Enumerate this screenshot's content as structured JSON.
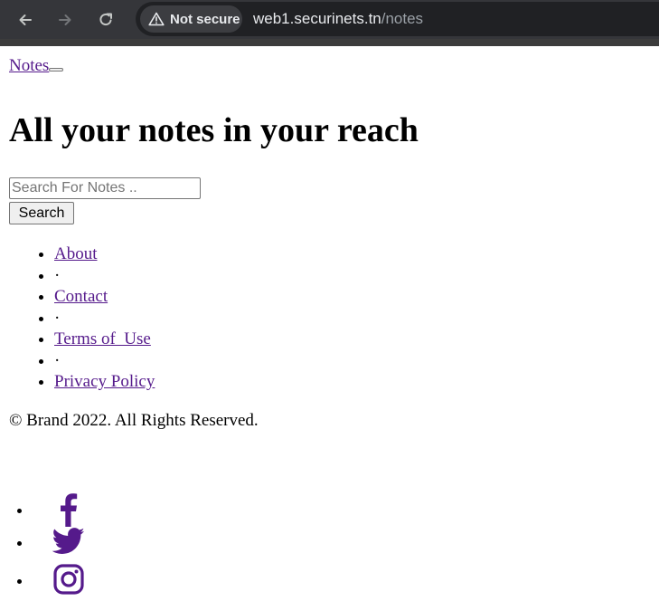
{
  "browser": {
    "security_label": "Not secure",
    "url_host": "web1.securinets.tn",
    "url_path": "/notes"
  },
  "navbar": {
    "brand": "Notes"
  },
  "hero": {
    "title": "All your notes in your reach"
  },
  "search": {
    "placeholder": "Search For Notes ..",
    "button_label": "Search"
  },
  "footer": {
    "links": [
      "About",
      "·",
      "Contact",
      "·",
      "Terms of  Use",
      "·",
      "Privacy Policy"
    ],
    "copyright": "© Brand 2022. All Rights Reserved."
  },
  "social": {
    "icons": [
      "facebook-icon",
      "twitter-icon",
      "instagram-icon"
    ],
    "color": "#551a8b"
  }
}
